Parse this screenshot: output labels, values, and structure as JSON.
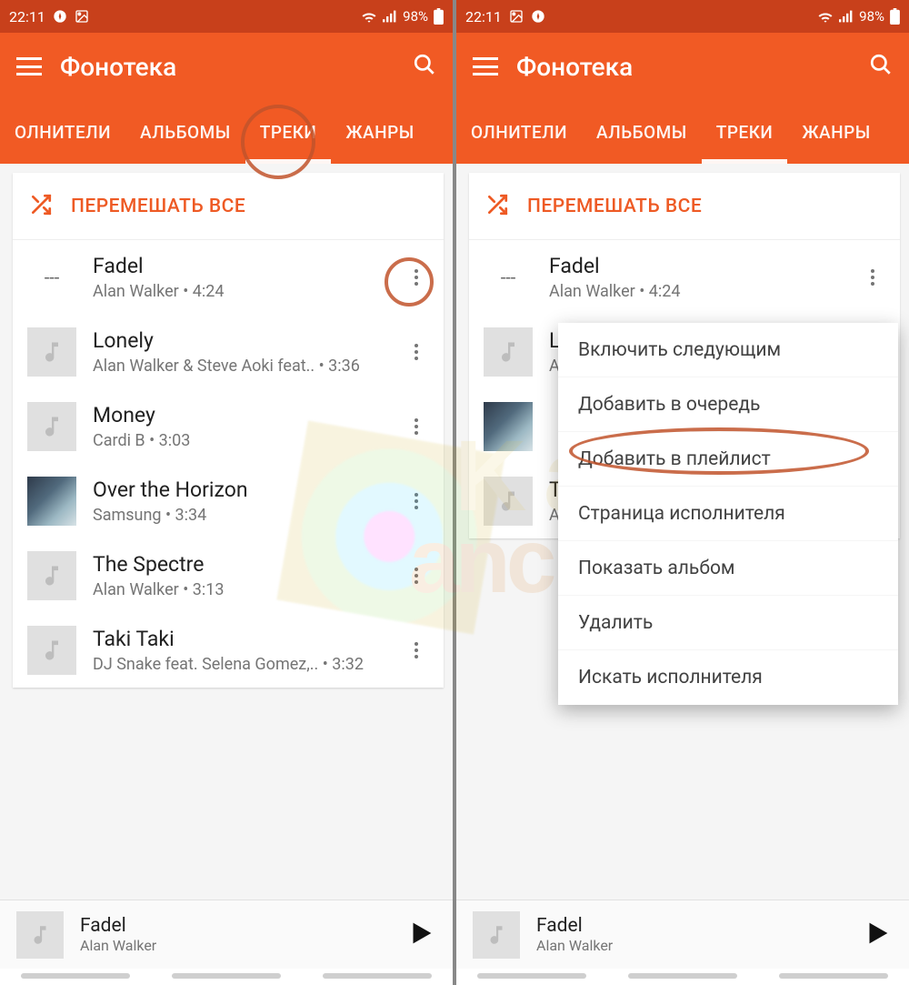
{
  "status": {
    "time": "22:11",
    "battery": "98%"
  },
  "appbar": {
    "title": "Фонотека"
  },
  "tabs": [
    {
      "label": "ОЛНИТЕЛИ"
    },
    {
      "label": "АЛЬБОМЫ"
    },
    {
      "label": "ТРЕКИ",
      "active": true
    },
    {
      "label": "ЖАНРЫ"
    }
  ],
  "shuffle": {
    "label": "ПЕРЕМЕШАТЬ ВСЕ"
  },
  "tracks": [
    {
      "title": "Fadel",
      "sub": "Alan Walker • 4:24",
      "thumb": "placeholder"
    },
    {
      "title": "Lonely",
      "sub": "Alan Walker & Steve Aoki feat.. • 3:36",
      "thumb": "note"
    },
    {
      "title": "Money",
      "sub": "Cardi B • 3:03",
      "thumb": "note"
    },
    {
      "title": "Over the Horizon",
      "sub": "Samsung • 3:34",
      "thumb": "art"
    },
    {
      "title": "The Spectre",
      "sub": "Alan Walker • 3:13",
      "thumb": "note"
    },
    {
      "title": "Taki Taki",
      "sub": "DJ Snake feat. Selena Gomez,.. • 3:32",
      "thumb": "note"
    }
  ],
  "truncated_tracks": [
    {
      "title": "Lo",
      "sub": "Al"
    },
    {
      "title": "Tl",
      "sub": "Al"
    }
  ],
  "menu": [
    "Включить следующим",
    "Добавить в очередь",
    "Добавить в плейлист",
    "Страница исполнителя",
    "Показать альбом",
    "Удалить",
    "Искать исполнителя"
  ],
  "nowplaying": {
    "title": "Fadel",
    "artist": "Alan Walker"
  },
  "watermark": {
    "t1": "K a",
    "t2": "anciula"
  }
}
